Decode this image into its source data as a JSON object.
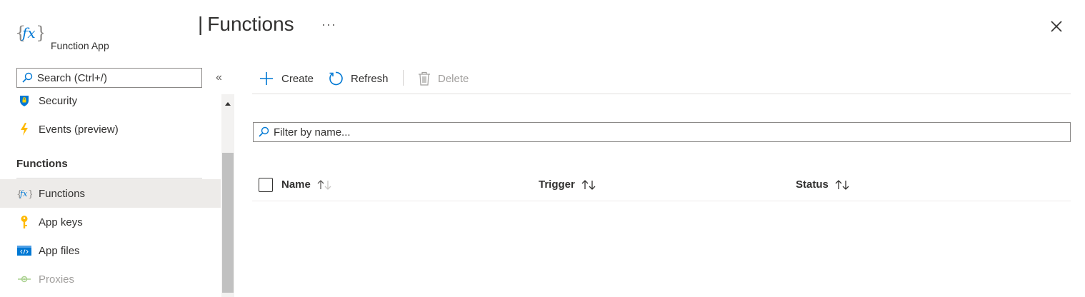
{
  "header": {
    "title": "Functions",
    "subtitle": "Function App",
    "more_label": "···"
  },
  "sidebar": {
    "search_placeholder": "Search (Ctrl+/)",
    "collapse_label": "«",
    "items_top": [
      {
        "label": "Security",
        "icon": "shield-icon"
      },
      {
        "label": "Events (preview)",
        "icon": "lightning-icon"
      }
    ],
    "section_title": "Functions",
    "items": [
      {
        "label": "Functions",
        "icon": "function-icon",
        "selected": true
      },
      {
        "label": "App keys",
        "icon": "key-icon"
      },
      {
        "label": "App files",
        "icon": "code-file-icon"
      },
      {
        "label": "Proxies",
        "icon": "proxy-icon",
        "disabled": true
      }
    ]
  },
  "toolbar": {
    "create_label": "Create",
    "refresh_label": "Refresh",
    "delete_label": "Delete"
  },
  "filter": {
    "placeholder": "Filter by name..."
  },
  "table": {
    "columns": [
      "Name",
      "Trigger",
      "Status"
    ]
  },
  "colors": {
    "accent": "#0078d4",
    "selected_bg": "#edebe9",
    "disabled_text": "#a19f9d"
  }
}
